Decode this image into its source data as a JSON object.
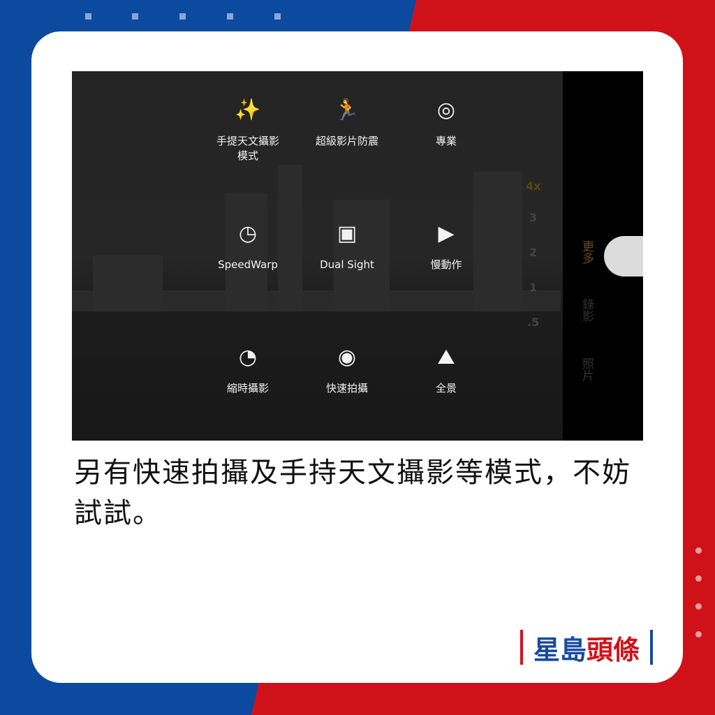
{
  "modes": [
    {
      "icon": "sparkles-icon",
      "glyph": "✨",
      "label": "手提天文攝影\n模式"
    },
    {
      "icon": "running-icon",
      "glyph": "🏃",
      "label": "超級影片防震"
    },
    {
      "icon": "aperture-icon",
      "glyph": "◎",
      "label": "專業"
    },
    {
      "icon": "speedwarp-icon",
      "glyph": "◷",
      "label": "SpeedWarp"
    },
    {
      "icon": "dual-sight-icon",
      "glyph": "▣",
      "label": "Dual Sight"
    },
    {
      "icon": "slow-motion-icon",
      "glyph": "▶",
      "label": "慢動作"
    },
    {
      "icon": "timelapse-icon",
      "glyph": "◔",
      "label": "縮時攝影"
    },
    {
      "icon": "quick-capture-icon",
      "glyph": "◉",
      "label": "快速拍攝"
    },
    {
      "icon": "panorama-icon",
      "glyph": "⛰",
      "label": "全景"
    }
  ],
  "tabs": {
    "more": "更多",
    "video": "錄影",
    "photo": "照片"
  },
  "zoom": {
    "z4": "4x",
    "z3": "3",
    "z2": "2",
    "z1": "1",
    "z05": ".5"
  },
  "caption": "另有快速拍攝及手持天文攝影等模式，不妨試試。",
  "logo": {
    "part1": "星島",
    "part2": "頭條"
  },
  "colors": {
    "blue": "#0b4a9e",
    "red": "#cf1219",
    "accent": "#e0a020"
  }
}
